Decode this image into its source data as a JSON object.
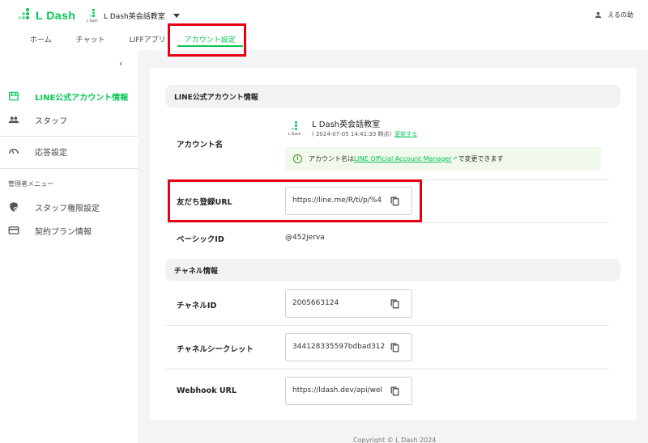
{
  "brand": {
    "name": "L Dash",
    "accent": "#06c755"
  },
  "account_selector": {
    "name": "L Dash英会話教室",
    "mini_logo_text": "L Dash"
  },
  "user": {
    "name": "えるの助"
  },
  "nav": {
    "tabs": [
      {
        "label": "ホーム"
      },
      {
        "label": "チャット"
      },
      {
        "label": "LIFFアプリ"
      },
      {
        "label": "アカウント設定",
        "active": true
      }
    ]
  },
  "sidebar": {
    "items": [
      {
        "label": "LINE公式アカウント情報",
        "icon": "store-icon",
        "active": true
      },
      {
        "label": "スタッフ",
        "icon": "people-icon"
      },
      {
        "label": "応答設定",
        "icon": "gauge-icon"
      }
    ],
    "admin_section_label": "管理者メニュー",
    "admin_items": [
      {
        "label": "スタッフ権限設定",
        "icon": "shield-settings-icon"
      },
      {
        "label": "契約プラン情報",
        "icon": "credit-card-icon"
      }
    ]
  },
  "main": {
    "line_info": {
      "heading": "LINE公式アカウント情報",
      "account_name_label": "アカウント名",
      "account_name": "L Dash英会話教室",
      "updated_at": "( 2024-07-05 14:41:33 時点)",
      "refresh_link": "更新する",
      "notice_prefix": "アカウント名は",
      "notice_link": "LINE Official Account Manager",
      "notice_suffix": "で変更できます",
      "friend_url_label": "友だち登録URL",
      "friend_url_value": "https://line.me/R/ti/p/%4",
      "basic_id_label": "ベーシックID",
      "basic_id_value": "@452jerva"
    },
    "channel_info": {
      "heading": "チャネル情報",
      "channel_id_label": "チャネルID",
      "channel_id_value": "2005663124",
      "channel_secret_label": "チャネルシークレット",
      "channel_secret_value": "344128335597bdbad312",
      "webhook_label": "Webhook URL",
      "webhook_value": "https://ldash.dev/api/wel"
    }
  },
  "footer": {
    "copyright": "Copyright © L Dash 2024"
  },
  "highlight_color": "#e60012"
}
